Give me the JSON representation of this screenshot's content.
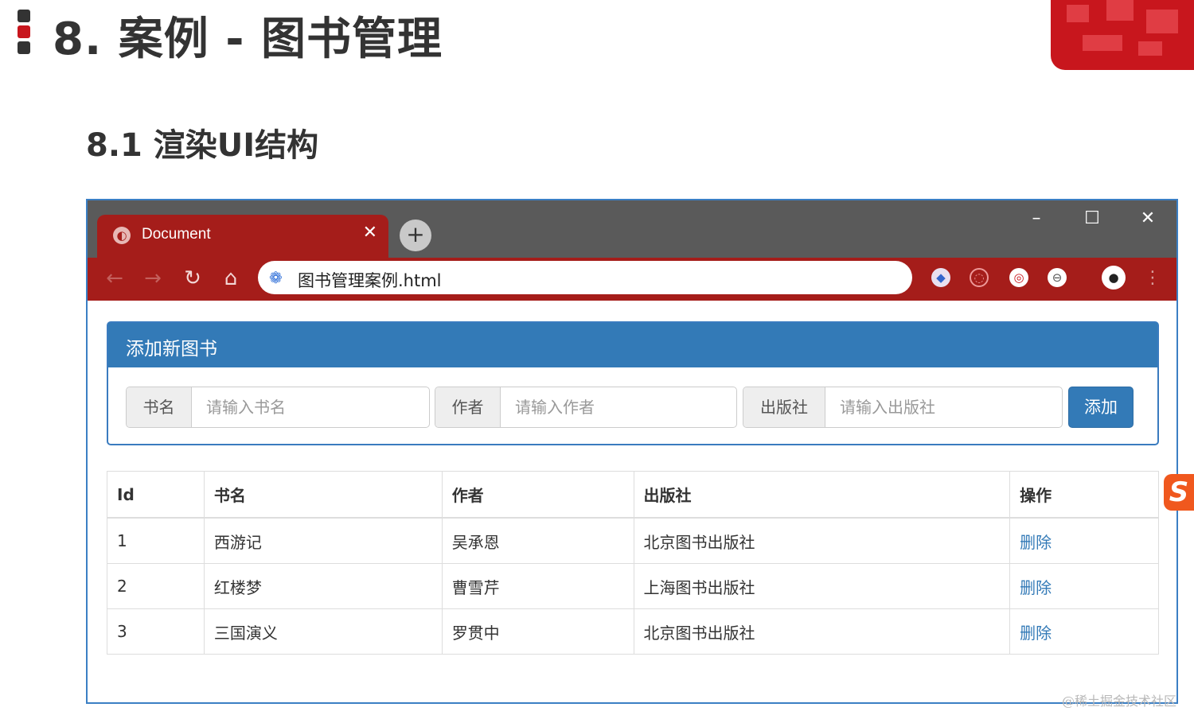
{
  "slide": {
    "title": "8. 案例 - 图书管理",
    "subtitle": "8.1 渲染UI结构"
  },
  "browser": {
    "tab_title": "Document",
    "tab_close_icon": "close-icon",
    "new_tab_label": "+",
    "window_controls": {
      "minimize": "–",
      "maximize": "☐",
      "close": "✕"
    },
    "nav": {
      "back": "←",
      "forward": "→",
      "reload": "↻",
      "home": "⌂"
    },
    "address": "图书管理案例.html",
    "menu": "⋮"
  },
  "panel": {
    "title": "添加新图书",
    "fields": [
      {
        "label": "书名",
        "placeholder": "请输入书名"
      },
      {
        "label": "作者",
        "placeholder": "请输入作者"
      },
      {
        "label": "出版社",
        "placeholder": "请输入出版社"
      }
    ],
    "add_button": "添加"
  },
  "table": {
    "headers": [
      "Id",
      "书名",
      "作者",
      "出版社",
      "操作"
    ],
    "rows": [
      {
        "id": "1",
        "name": "西游记",
        "author": "吴承恩",
        "publisher": "北京图书出版社",
        "action": "删除"
      },
      {
        "id": "2",
        "name": "红楼梦",
        "author": "曹雪芹",
        "publisher": "上海图书出版社",
        "action": "删除"
      },
      {
        "id": "3",
        "name": "三国演义",
        "author": "罗贯中",
        "publisher": "北京图书出版社",
        "action": "删除"
      }
    ]
  },
  "watermark": "@稀土掘金技术社区",
  "colors": {
    "accent": "#c8161d",
    "primary": "#337ab7",
    "tab": "#a51d1a"
  }
}
